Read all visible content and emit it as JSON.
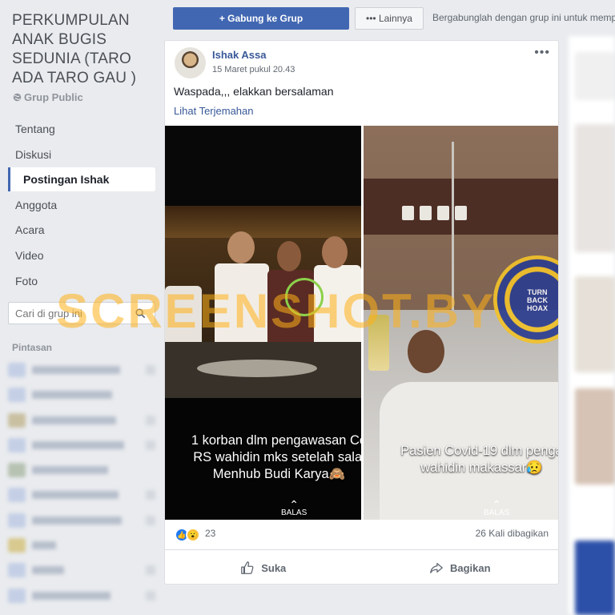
{
  "sidebar": {
    "group_title": "PERKUMPULAN ANAK BUGIS SEDUNIA (TARO ADA TARO GAU )",
    "group_type": "Grup Public",
    "nav": [
      {
        "label": "Tentang"
      },
      {
        "label": "Diskusi"
      },
      {
        "label": "Postingan Ishak",
        "active": true
      },
      {
        "label": "Anggota"
      },
      {
        "label": "Acara"
      },
      {
        "label": "Video"
      },
      {
        "label": "Foto"
      }
    ],
    "search_placeholder": "Cari di grup ini",
    "shortcuts_label": "Pintasan"
  },
  "topbar": {
    "join_label": "+ Gabung ke Grup",
    "more_label": "••• Lainnya",
    "join_hint": "Bergabunglah dengan grup ini untuk memp"
  },
  "post": {
    "author": "Ishak Assa",
    "time": "15 Maret pukul 20.43",
    "menu_icon": "•••",
    "text": "Waspada,,, elakkan bersalaman",
    "translate": "Lihat Terjemahan",
    "photo_left_caption": [
      "1 korban dlm pengawasan Co",
      "RS wahidin mks setelah salai",
      "Menhub Budi Karya🙈"
    ],
    "photo_right_caption": [
      "Pasien Covid-19 dlm penga",
      "wahidin makassar😥"
    ],
    "reply_hint": "BALAS",
    "stamp_text": "TURN BACK HOAX",
    "watermark": "SCREENSHOT.BY",
    "reaction_count": "23",
    "share_count": "26 Kali dibagikan",
    "like_label": "Suka",
    "share_label": "Bagikan"
  },
  "colors": {
    "accent": "#4267b2",
    "link": "#385898",
    "background": "#e9ebee"
  }
}
